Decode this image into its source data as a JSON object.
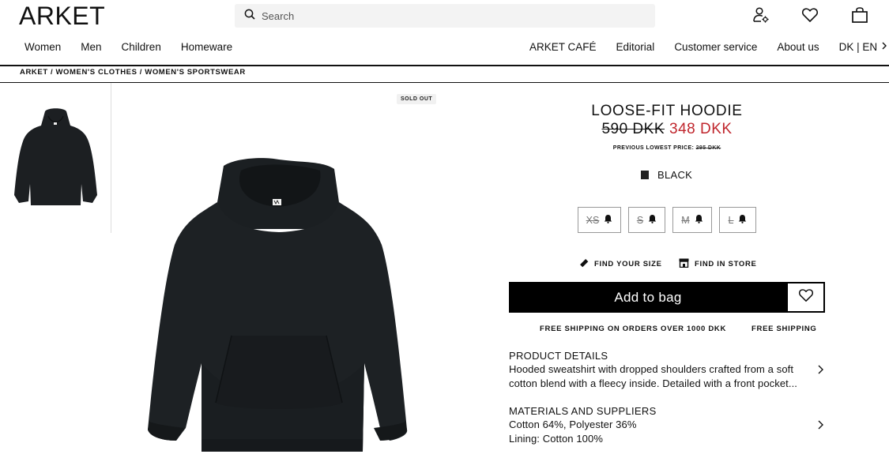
{
  "header": {
    "logo": "ARKET",
    "search_placeholder": "Search"
  },
  "nav": {
    "left": [
      "Women",
      "Men",
      "Children",
      "Homeware"
    ],
    "right": [
      "ARKET CAFÉ",
      "Editorial",
      "Customer service",
      "About us"
    ],
    "locale": "DK | EN"
  },
  "breadcrumb": "ARKET / WOMEN'S CLOTHES / WOMEN'S SPORTSWEAR",
  "product": {
    "badge": "SOLD OUT",
    "title": "LOOSE-FIT HOODIE",
    "old_price": "590 DKK",
    "new_price": "348 DKK",
    "prev_lowest_label": "PREVIOUS LOWEST PRICE:",
    "prev_lowest_value": "295 DKK",
    "color_name": "BLACK",
    "color_hex": "#222222",
    "sale_color": "#c0262d",
    "sizes": [
      "XS",
      "S",
      "M",
      "L"
    ],
    "find_size": "FIND YOUR SIZE",
    "find_store": "FIND IN STORE",
    "add_to_bag": "Add to bag",
    "shipping_note": "FREE SHIPPING ON ORDERS OVER 1000 DKK",
    "shipping_free": "FREE SHIPPING",
    "details_title": "PRODUCT DETAILS",
    "details_line1": "Hooded sweatshirt with dropped shoulders crafted from a soft",
    "details_line2": "cotton blend with a fleecy inside. Detailed with a front pocket...",
    "materials_title": "MATERIALS AND SUPPLIERS",
    "materials_line1": "Cotton 64%, Polyester 36%",
    "materials_line2": "Lining: Cotton 100%"
  },
  "icons": [
    "search-icon",
    "account-icon",
    "heart-icon",
    "bag-icon",
    "chevron-right-icon",
    "bell-icon",
    "ruler-icon",
    "store-icon"
  ]
}
